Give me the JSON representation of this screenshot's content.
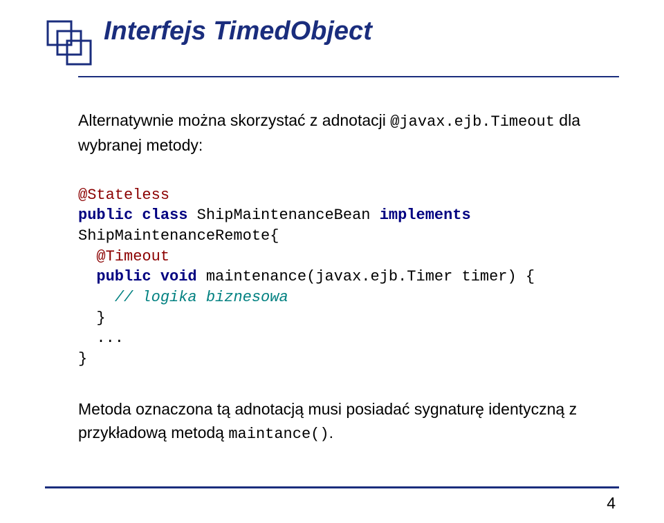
{
  "title": "Interfejs TimedObject",
  "intro": {
    "text1": "Alternatywnie można skorzystać z adnotacji ",
    "code": "@javax.ejb.Timeout",
    "text2": " dla wybranej metody:"
  },
  "code": {
    "line1_annotation": "@Stateless",
    "line2_kw1": "public",
    "line2_kw2": "class",
    "line2_name": " ShipMaintenanceBean ",
    "line2_kw3": "implements",
    "line3_name": "ShipMaintenanceRemote{",
    "line4_annotation": "  @Timeout",
    "line5_indent": "  ",
    "line5_kw1": "public",
    "line5_kw2": "void",
    "line5_rest": " maintenance(javax.ejb.Timer timer) {",
    "line6_indent": "    ",
    "line6_comment": "// logika biznesowa",
    "line7": "  }",
    "line8": "  ...",
    "line9": "}"
  },
  "footer": {
    "text1": "Metoda oznaczona tą adnotacją musi posiadać sygnaturę identyczną z  przykładową metodą ",
    "code": "maintance()",
    "text2": "."
  },
  "page_number": "4"
}
